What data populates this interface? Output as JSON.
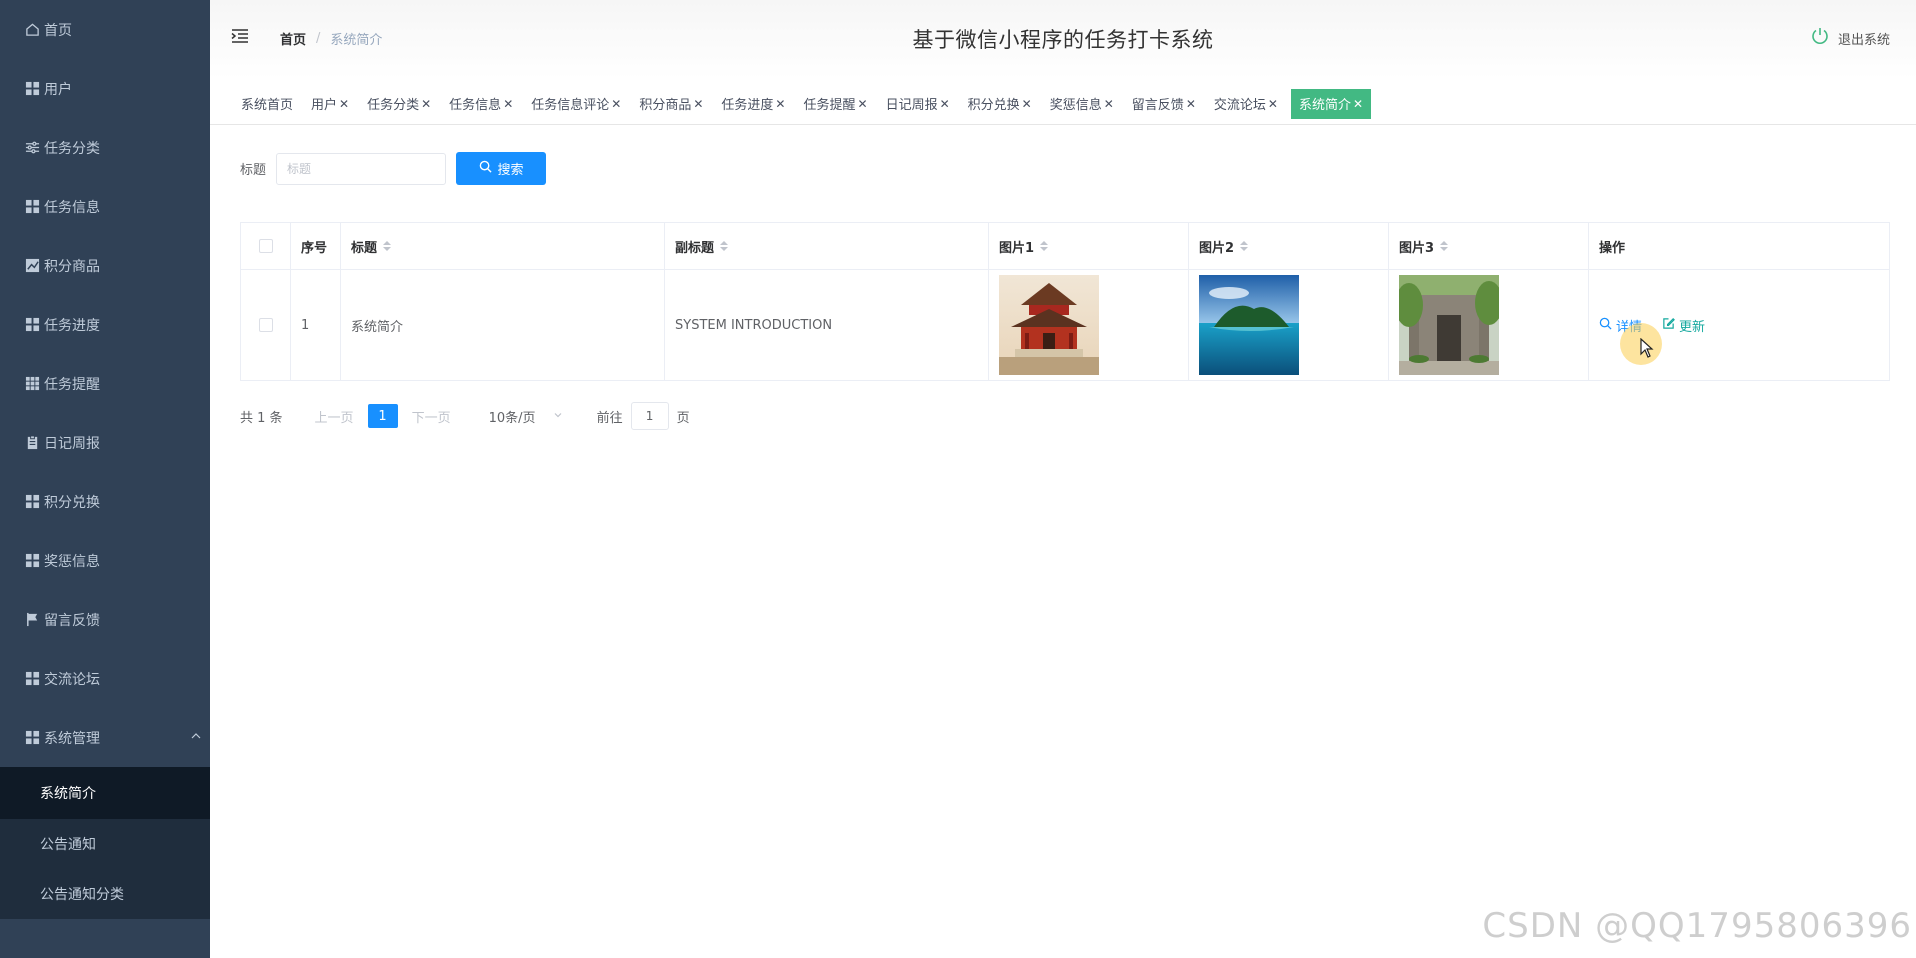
{
  "app": {
    "title": "基于微信小程序的任务打卡系统",
    "logout_label": "退出系统"
  },
  "breadcrumb": {
    "home": "首页",
    "current": "系统简介"
  },
  "sidebar": {
    "items": [
      {
        "label": "首页",
        "icon": "home-icon"
      },
      {
        "label": "用户",
        "icon": "grid-icon"
      },
      {
        "label": "任务分类",
        "icon": "sliders-icon"
      },
      {
        "label": "任务信息",
        "icon": "grid-icon"
      },
      {
        "label": "积分商品",
        "icon": "chart-icon"
      },
      {
        "label": "任务进度",
        "icon": "grid-icon"
      },
      {
        "label": "任务提醒",
        "icon": "grid-icon"
      },
      {
        "label": "日记周报",
        "icon": "clipboard-icon"
      },
      {
        "label": "积分兑换",
        "icon": "grid-icon"
      },
      {
        "label": "奖惩信息",
        "icon": "grid-icon"
      },
      {
        "label": "留言反馈",
        "icon": "flag-icon"
      },
      {
        "label": "交流论坛",
        "icon": "grid-icon"
      },
      {
        "label": "系统管理",
        "icon": "grid-icon"
      }
    ],
    "submenu": [
      {
        "label": "系统简介",
        "active": true
      },
      {
        "label": "公告通知",
        "active": false
      },
      {
        "label": "公告通知分类",
        "active": false
      }
    ]
  },
  "tags": [
    {
      "label": "系统首页",
      "closable": false,
      "active": false
    },
    {
      "label": "用户",
      "closable": true,
      "active": false
    },
    {
      "label": "任务分类",
      "closable": true,
      "active": false
    },
    {
      "label": "任务信息",
      "closable": true,
      "active": false
    },
    {
      "label": "任务信息评论",
      "closable": true,
      "active": false
    },
    {
      "label": "积分商品",
      "closable": true,
      "active": false
    },
    {
      "label": "任务进度",
      "closable": true,
      "active": false
    },
    {
      "label": "任务提醒",
      "closable": true,
      "active": false
    },
    {
      "label": "日记周报",
      "closable": true,
      "active": false
    },
    {
      "label": "积分兑换",
      "closable": true,
      "active": false
    },
    {
      "label": "奖惩信息",
      "closable": true,
      "active": false
    },
    {
      "label": "留言反馈",
      "closable": true,
      "active": false
    },
    {
      "label": "交流论坛",
      "closable": true,
      "active": false
    },
    {
      "label": "系统简介",
      "closable": true,
      "active": true
    }
  ],
  "search": {
    "label": "标题",
    "placeholder": "标题",
    "button": "搜索"
  },
  "table": {
    "headers": {
      "index": "序号",
      "title": "标题",
      "subtitle": "副标题",
      "image1": "图片1",
      "image2": "图片2",
      "image3": "图片3",
      "actions": "操作"
    },
    "rows": [
      {
        "index": "1",
        "title": "系统简介",
        "subtitle": "SYSTEM INTRODUCTION",
        "image1": "pagoda-photo",
        "image2": "island-photo",
        "image3": "courtyard-photo",
        "detail": "详情",
        "update": "更新"
      }
    ]
  },
  "pagination": {
    "total": "共 1 条",
    "prev": "上一页",
    "current": "1",
    "next": "下一页",
    "page_size": "10条/页",
    "goto": "前往",
    "goto_value": "1",
    "page_unit": "页"
  },
  "watermark": "CSDN @QQ1795806396",
  "colors": {
    "sidebar": "#304156",
    "active_tag": "#42b983",
    "primary": "#1890ff"
  }
}
